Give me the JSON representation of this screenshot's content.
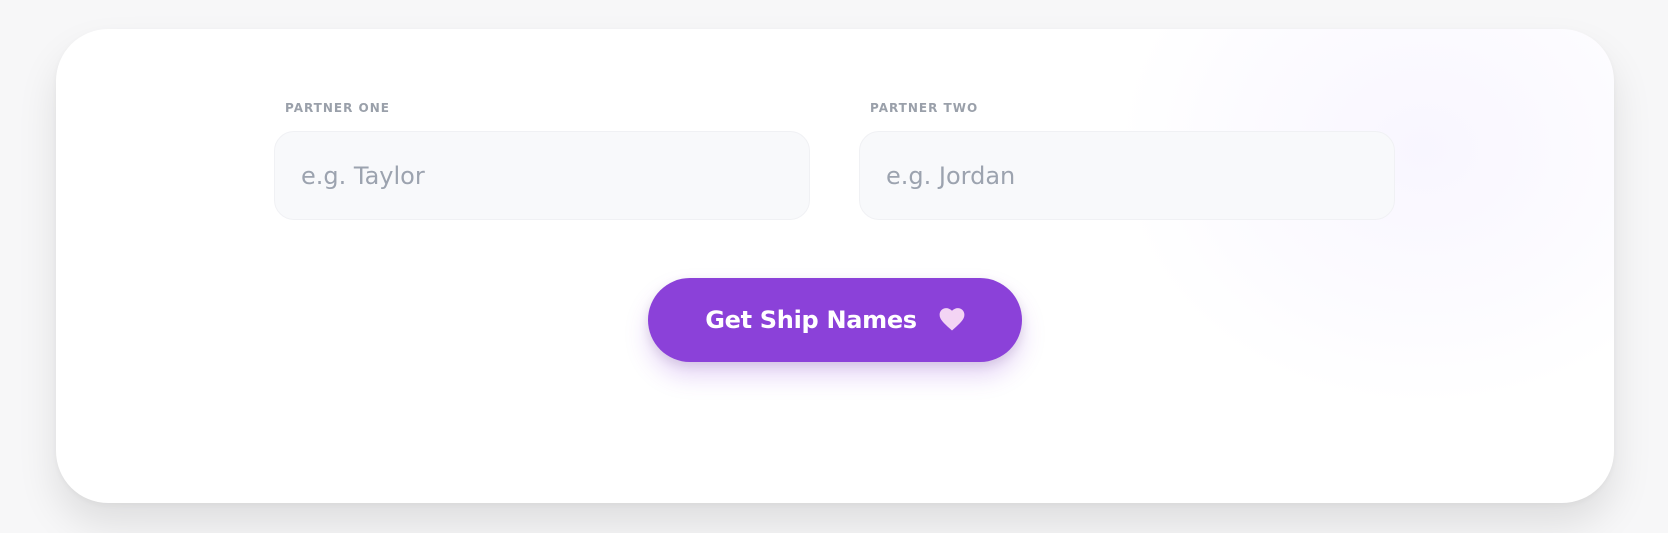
{
  "form": {
    "partner_one": {
      "label": "PARTNER ONE",
      "value": "",
      "placeholder": "e.g. Taylor"
    },
    "partner_two": {
      "label": "PARTNER TWO",
      "value": "",
      "placeholder": "e.g. Jordan"
    },
    "submit": {
      "label": "Get Ship Names",
      "icon": "heart-icon"
    }
  },
  "colors": {
    "accent": "#8b41d9",
    "heart": "#f3d4f4",
    "label": "#9aa0aa",
    "input_bg": "#f8f9fb",
    "placeholder": "#9ca3af"
  }
}
